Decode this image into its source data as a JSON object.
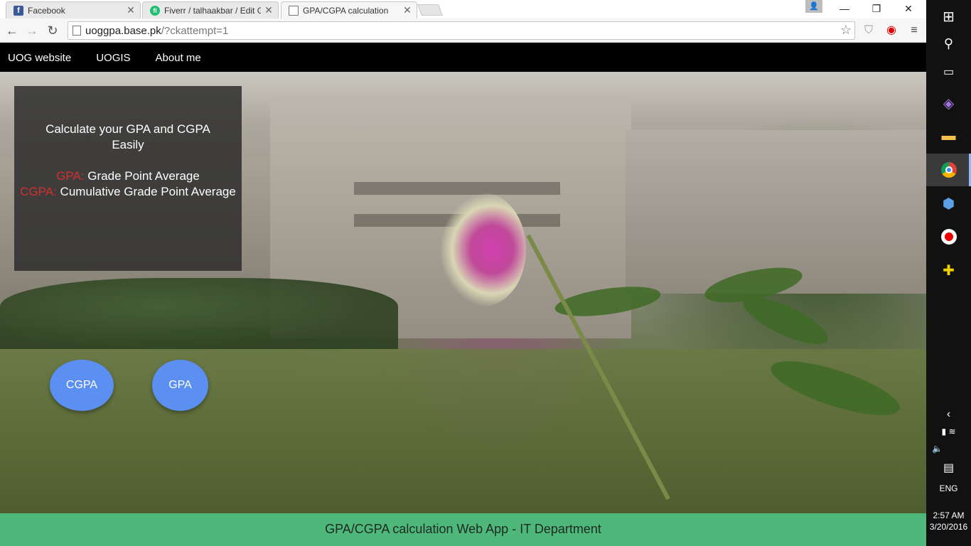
{
  "browser": {
    "tabs": [
      {
        "title": "Facebook",
        "icon": "facebook-icon"
      },
      {
        "title": "Fiverr / talhaakbar / Edit G",
        "icon": "fiverr-icon"
      },
      {
        "title": "GPA/CGPA calculation",
        "icon": "document-icon",
        "active": true
      }
    ],
    "url_host": "uoggpa.base.pk",
    "url_rest": "/?ckattempt=1"
  },
  "nav": {
    "items": [
      "UOG website",
      "UOGIS",
      "About me"
    ]
  },
  "card": {
    "heading_line1": "Calculate your GPA and CGPA",
    "heading_line2": "Easily",
    "gpa_abbr": "GPA:",
    "gpa_text": "Grade Point Average",
    "cgpa_abbr": "CGPA:",
    "cgpa_text": "Cumulative Grade Point Average"
  },
  "buttons": {
    "cgpa": "CGPA",
    "gpa": "GPA"
  },
  "footer": {
    "text": "GPA/CGPA calculation Web App - IT Department"
  },
  "taskbar": {
    "language": "ENG",
    "time": "2:57 AM",
    "date": "3/20/2016"
  },
  "colors": {
    "nav_bg": "#000000",
    "footer_bg": "#4db879",
    "button_bg": "#5b8ff2",
    "abbr_red": "#d32f2f"
  }
}
